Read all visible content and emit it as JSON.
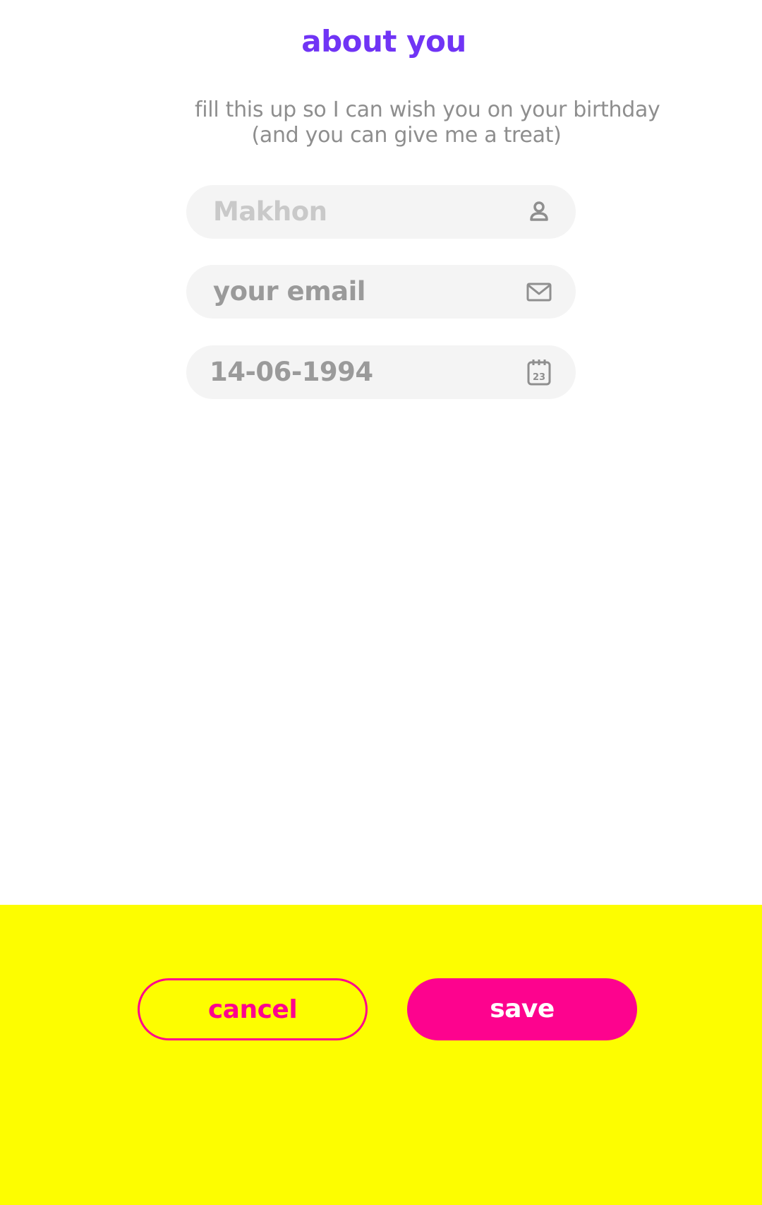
{
  "header": {
    "title": "about you"
  },
  "intro": {
    "line1": "fill this up so I can wish you on your birthday",
    "line2": "(and you can give me a treat)"
  },
  "form": {
    "name": {
      "placeholder": "Makhon",
      "icon": "person-icon"
    },
    "email": {
      "placeholder": "your email",
      "icon": "mail-icon"
    },
    "birthday": {
      "value": "14-06-1994",
      "icon": "calendar-icon",
      "icon_day": "23"
    }
  },
  "actions": {
    "cancel_label": "cancel",
    "save_label": "save"
  },
  "colors": {
    "title": "#7034f5",
    "accent": "#fd038e",
    "footer_bg": "#fdfd00",
    "field_bg": "#f4f4f4"
  }
}
